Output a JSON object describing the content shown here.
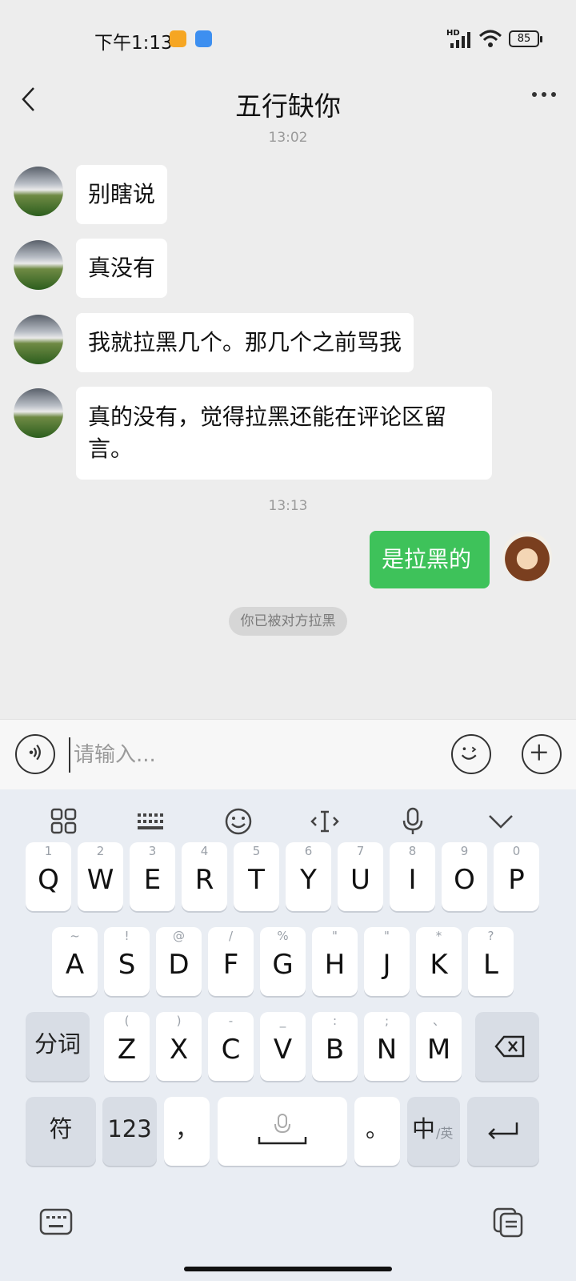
{
  "status_bar": {
    "time": "下午1:13",
    "network": "HD",
    "battery": "85",
    "icons": [
      "notification-app-icon",
      "notification-calendar-icon",
      "signal-icon",
      "wifi-icon",
      "battery-icon"
    ]
  },
  "header": {
    "title": "五行缺你",
    "icons": [
      "back-icon",
      "more-icon"
    ]
  },
  "messages": {
    "timestamp_1": "13:02",
    "incoming": [
      {
        "text": "别瞎说"
      },
      {
        "text": "真没有"
      },
      {
        "text": "我就拉黑几个。那几个之前骂我"
      },
      {
        "line1": "真的没有，觉得拉黑还能在评论区留",
        "line2": "言。"
      }
    ],
    "timestamp_2": "13:13",
    "outgoing": [
      {
        "text": "是拉黑的"
      }
    ],
    "notice": "你已被对方拉黑"
  },
  "input_bar": {
    "placeholder": "请输入...",
    "icons": [
      "voice-icon",
      "emoji-icon",
      "plus-icon"
    ]
  },
  "keyboard": {
    "toolbar_icons": [
      "apps-grid-icon",
      "keyboard-icon",
      "smiley-icon",
      "cursor-icon",
      "microphone-icon",
      "chevron-down-icon"
    ],
    "row1": [
      {
        "main": "Q",
        "sub": "1"
      },
      {
        "main": "W",
        "sub": "2"
      },
      {
        "main": "E",
        "sub": "3"
      },
      {
        "main": "R",
        "sub": "4"
      },
      {
        "main": "T",
        "sub": "5"
      },
      {
        "main": "Y",
        "sub": "6"
      },
      {
        "main": "U",
        "sub": "7"
      },
      {
        "main": "I",
        "sub": "8"
      },
      {
        "main": "O",
        "sub": "9"
      },
      {
        "main": "P",
        "sub": "0"
      }
    ],
    "row2": [
      {
        "main": "A",
        "sub": "~"
      },
      {
        "main": "S",
        "sub": "!"
      },
      {
        "main": "D",
        "sub": "@"
      },
      {
        "main": "F",
        "sub": "/"
      },
      {
        "main": "G",
        "sub": "%"
      },
      {
        "main": "H",
        "sub": "\""
      },
      {
        "main": "J",
        "sub": "\""
      },
      {
        "main": "K",
        "sub": "*"
      },
      {
        "main": "L",
        "sub": "?"
      }
    ],
    "row3": [
      {
        "main": "Z",
        "sub": "("
      },
      {
        "main": "X",
        "sub": ")"
      },
      {
        "main": "C",
        "sub": "-"
      },
      {
        "main": "V",
        "sub": "_"
      },
      {
        "main": "B",
        "sub": ":"
      },
      {
        "main": "N",
        "sub": ";"
      },
      {
        "main": "M",
        "sub": "、"
      }
    ],
    "shift_label": "分词",
    "symbols_label": "符",
    "numbers_label": "123",
    "comma_label": "，",
    "period_label": "。",
    "lang_main": "中",
    "lang_sub": "/英",
    "bottom_icons": [
      "keyboard-switch-icon",
      "clipboard-icon"
    ]
  }
}
